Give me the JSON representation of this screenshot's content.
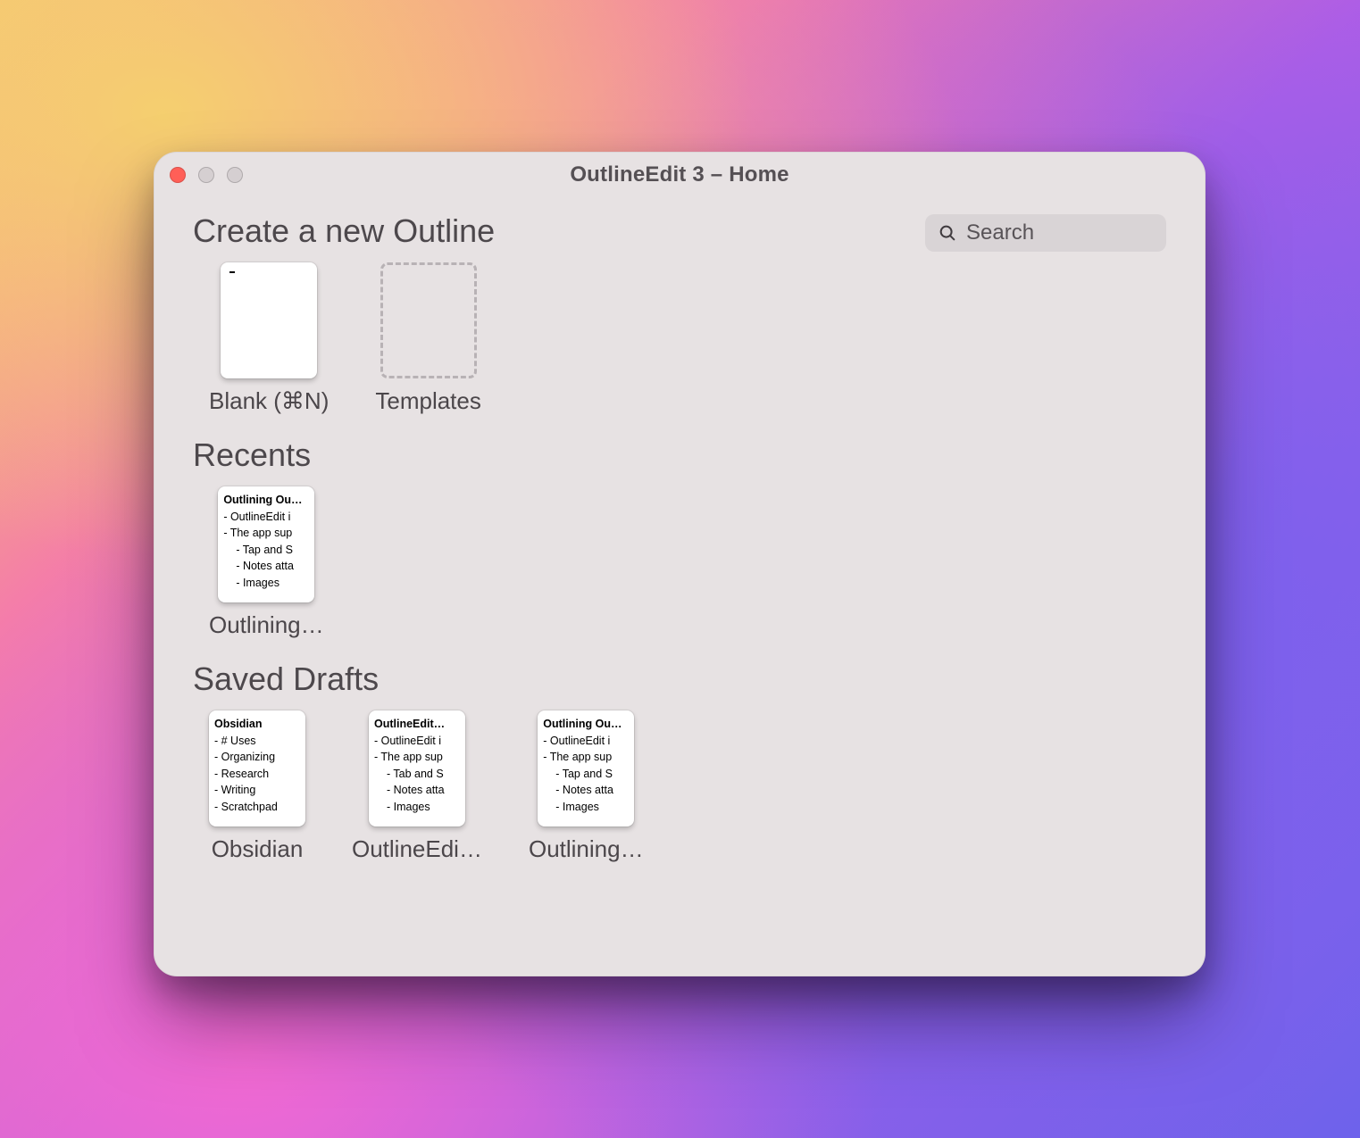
{
  "window": {
    "title": "OutlineEdit 3 – Home"
  },
  "search": {
    "placeholder": "Search",
    "value": ""
  },
  "sections": {
    "create": {
      "heading": "Create a new Outline",
      "blank_label": "Blank (⌘N)",
      "templates_label": "Templates"
    },
    "recents": {
      "heading": "Recents",
      "items": [
        {
          "label": "Outlining…",
          "preview_title": "Outlining Ou…",
          "lines": [
            {
              "text": "- OutlineEdit i",
              "indent": 1
            },
            {
              "text": "- The app sup",
              "indent": 1
            },
            {
              "text": "- Tap and S",
              "indent": 2
            },
            {
              "text": "- Notes atta",
              "indent": 2
            },
            {
              "text": "- Images",
              "indent": 2
            }
          ]
        }
      ]
    },
    "drafts": {
      "heading": "Saved Drafts",
      "items": [
        {
          "label": "Obsidian",
          "preview_title": "Obsidian",
          "lines": [
            {
              "text": "- # Uses",
              "indent": 1
            },
            {
              "text": "- Organizing",
              "indent": 1
            },
            {
              "text": "- Research",
              "indent": 1
            },
            {
              "text": "- Writing",
              "indent": 1
            },
            {
              "text": "- Scratchpad",
              "indent": 1
            }
          ]
        },
        {
          "label": "OutlineEdi…",
          "preview_title": "OutlineEdit…",
          "lines": [
            {
              "text": "- OutlineEdit i",
              "indent": 1
            },
            {
              "text": "- The app sup",
              "indent": 1
            },
            {
              "text": "- Tab and S",
              "indent": 2
            },
            {
              "text": "- Notes atta",
              "indent": 2
            },
            {
              "text": "- Images",
              "indent": 2
            }
          ]
        },
        {
          "label": "Outlining…",
          "preview_title": "Outlining Ou…",
          "lines": [
            {
              "text": "- OutlineEdit i",
              "indent": 1
            },
            {
              "text": "- The app sup",
              "indent": 1
            },
            {
              "text": "- Tap and S",
              "indent": 2
            },
            {
              "text": "- Notes atta",
              "indent": 2
            },
            {
              "text": "- Images",
              "indent": 2
            }
          ]
        }
      ]
    }
  }
}
